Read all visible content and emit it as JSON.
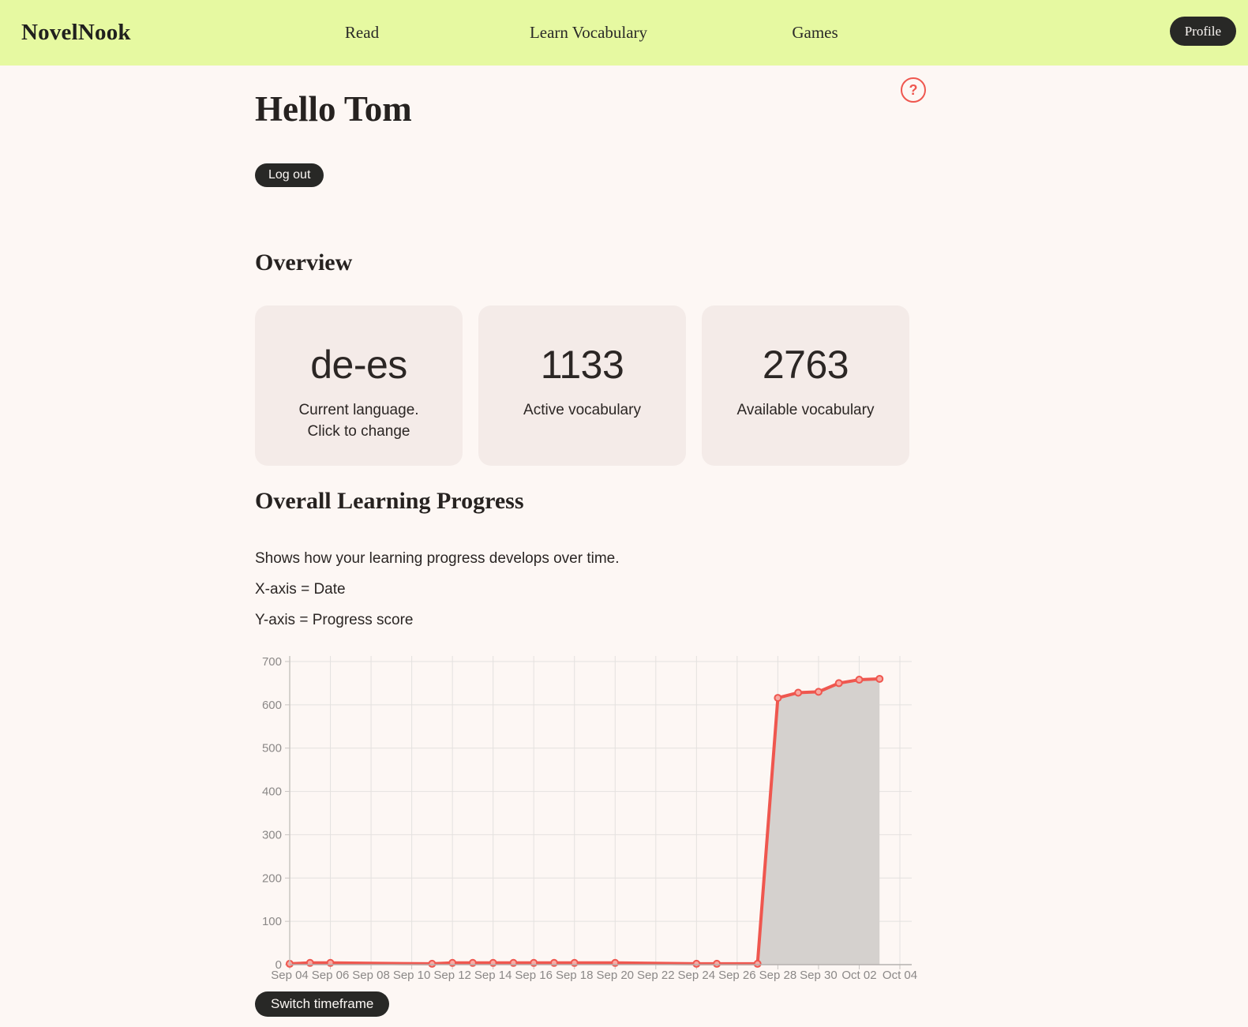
{
  "nav": {
    "brand": "NovelNook",
    "items": [
      {
        "label": "Read"
      },
      {
        "label": "Learn Vocabulary"
      },
      {
        "label": "Games"
      }
    ],
    "profile_label": "Profile"
  },
  "header": {
    "greeting": "Hello Tom",
    "logout_label": "Log out",
    "help_glyph": "?"
  },
  "overview": {
    "title": "Overview",
    "cards": [
      {
        "value": "de-es",
        "label_lines": [
          "Current language.",
          "Click to change"
        ]
      },
      {
        "value": "1133",
        "label_lines": [
          "Active vocabulary"
        ]
      },
      {
        "value": "2763",
        "label_lines": [
          "Available vocabulary"
        ]
      }
    ]
  },
  "progress": {
    "title": "Overall Learning Progress",
    "description": "Shows how your learning progress develops over time.",
    "x_axis_note": "X-axis = Date",
    "y_axis_note": "Y-axis = Progress score",
    "switch_label": "Switch timeframe"
  },
  "colors": {
    "nav_bg": "#e6f9a1",
    "page_bg": "#fdf7f4",
    "card_bg": "#f4ebe8",
    "button_bg": "#282826",
    "accent_red": "#ef574f",
    "chart_line": "#ef574f",
    "chart_area": "#d5d1ce",
    "grid_line": "#e4e1df",
    "tick_text": "#8b8887"
  },
  "chart_data": {
    "type": "area",
    "title": "",
    "xlabel": "Date",
    "ylabel": "Progress score",
    "grid": true,
    "legend": false,
    "ylim": [
      0,
      700
    ],
    "y_ticks": [
      0,
      100,
      200,
      300,
      400,
      500,
      600,
      700
    ],
    "x_ticks": [
      "Sep 04",
      "Sep 06",
      "Sep 08",
      "Sep 10",
      "Sep 12",
      "Sep 14",
      "Sep 16",
      "Sep 18",
      "Sep 20",
      "Sep 22",
      "Sep 24",
      "Sep 26",
      "Sep 28",
      "Sep 30",
      "Oct 02",
      "Oct 04"
    ],
    "x_tick_day_index": [
      0,
      2,
      4,
      6,
      8,
      10,
      12,
      14,
      16,
      18,
      20,
      22,
      24,
      26,
      28,
      30
    ],
    "x_total_days": 30,
    "series": [
      {
        "name": "Progress score",
        "day_index": [
          0,
          1,
          2,
          7,
          8,
          9,
          10,
          11,
          12,
          13,
          14,
          16,
          20,
          21,
          23,
          24,
          25,
          26,
          27,
          28,
          29
        ],
        "points": [
          {
            "date": "Sep 04",
            "value": 2
          },
          {
            "date": "Sep 05",
            "value": 4
          },
          {
            "date": "Sep 06",
            "value": 4
          },
          {
            "date": "Sep 11",
            "value": 2
          },
          {
            "date": "Sep 12",
            "value": 4
          },
          {
            "date": "Sep 13",
            "value": 4
          },
          {
            "date": "Sep 14",
            "value": 4
          },
          {
            "date": "Sep 15",
            "value": 4
          },
          {
            "date": "Sep 16",
            "value": 4
          },
          {
            "date": "Sep 17",
            "value": 4
          },
          {
            "date": "Sep 18",
            "value": 4
          },
          {
            "date": "Sep 20",
            "value": 4
          },
          {
            "date": "Sep 24",
            "value": 2
          },
          {
            "date": "Sep 25",
            "value": 2
          },
          {
            "date": "Sep 27",
            "value": 2
          },
          {
            "date": "Sep 28",
            "value": 616
          },
          {
            "date": "Sep 29",
            "value": 628
          },
          {
            "date": "Sep 30",
            "value": 630
          },
          {
            "date": "Oct 01",
            "value": 650
          },
          {
            "date": "Oct 02",
            "value": 658
          },
          {
            "date": "Oct 03",
            "value": 660
          }
        ]
      }
    ],
    "line_color": "#ef574f",
    "marker_fill": "#f8a9a3",
    "area_fill": "#d5d1ce"
  }
}
